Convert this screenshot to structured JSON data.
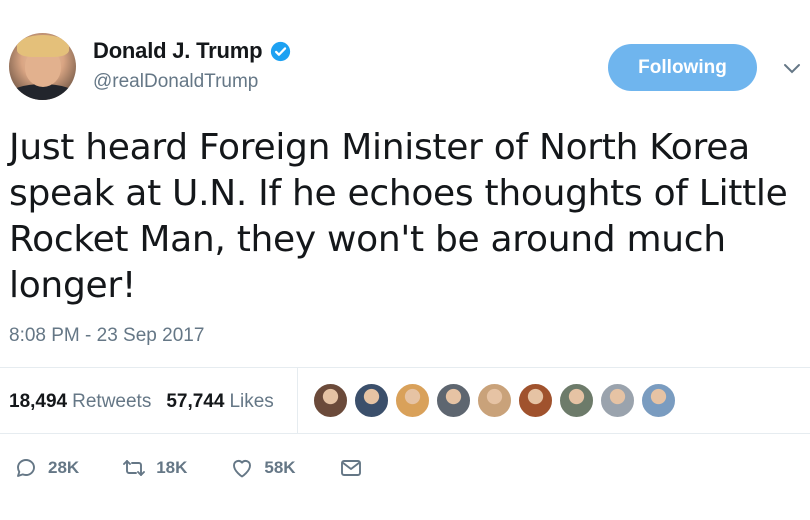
{
  "author": {
    "display_name": "Donald J. Trump",
    "handle": "@realDonaldTrump",
    "verified": true,
    "avatar_icon": "profile-photo"
  },
  "follow_button": {
    "label": "Following"
  },
  "menu_icon": "chevron-down-icon",
  "tweet": {
    "lines": [
      "Just heard Foreign Minister of North Korea",
      "speak at U.N. If he echoes thoughts of Little",
      "Rocket Man, they won't be around much",
      "longer!"
    ],
    "timestamp": "8:08 PM - 23 Sep 2017"
  },
  "stats": {
    "retweets_count": "18,494",
    "retweets_label": "Retweets",
    "likes_count": "57,744",
    "likes_label": "Likes",
    "liker_avatar_colors": [
      "#6b4a3a",
      "#3b4f6b",
      "#d9a15a",
      "#5e6670",
      "#c9a27a",
      "#a0522d",
      "#6d7b6a",
      "#9aa3ad",
      "#7a9cc0"
    ]
  },
  "actions": {
    "reply_count": "28K",
    "retweet_count": "18K",
    "like_count": "58K"
  },
  "colors": {
    "accent": "#6fb5ee",
    "verified": "#1da1f2",
    "muted": "#657786"
  }
}
